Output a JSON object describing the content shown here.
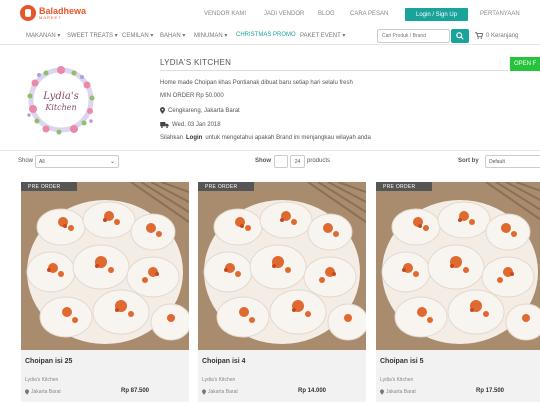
{
  "logo": {
    "main": "Baladhewa",
    "sub": "MARKET"
  },
  "top_links": [
    "VENDOR KAMI",
    "JADI VENDOR",
    "BLOG",
    "CARA PESAN"
  ],
  "login_label": "Login / Sign Up",
  "help_label": "PERTANYAAN",
  "nav": [
    "MAKANAN ▾",
    "SWEET TREATS ▾",
    "CEMILAN ▾",
    "BAHAN ▾",
    "MINUMAN ▾",
    "CHRISTMAS PROMO",
    "PAKET EVENT ▾"
  ],
  "search": {
    "placeholder": "Cari Produk / Brand"
  },
  "cart_label": "0 Keranjang",
  "store": {
    "logo_text_1": "Lydia's",
    "logo_text_2": "Kitchen",
    "name": "LYDIA'S KITCHEN",
    "status": "OPEN F",
    "description": "Home made Choipan khas Pontianak dibuat baru setiap hari selalu fresh",
    "min_order": "MIN ORDER Rp 50.000",
    "location": "Cengkareng, Jakarta Barat",
    "date": "Wed, 03 Jan 2018",
    "login_note_pre": "Silahkan",
    "login_note_link": "Login",
    "login_note_post": "untuk mengetahui apakah Brand ini menjangkau wilayah anda"
  },
  "filters": {
    "show_label": "Show",
    "show_value": "All",
    "per_page_label": "Show",
    "per_page_current": "",
    "per_page_value": "24",
    "per_page_suffix": "products",
    "sort_label": "Sort by",
    "sort_value": "Default"
  },
  "products": [
    {
      "badge": "PRE ORDER",
      "name": "Choipan isi 25",
      "store": "Lydia's Kitchen",
      "location": "Jakarta Barat",
      "price": "Rp 87.500"
    },
    {
      "badge": "PRE ORDER",
      "name": "Choipan isi 4",
      "store": "Lydia's Kitchen",
      "location": "Jakarta Barat",
      "price": "Rp 14.000"
    },
    {
      "badge": "PRE ORDER",
      "name": "Choipan isi 5",
      "store": "Lydia's Kitchen",
      "location": "Jakarta Barat",
      "price": "Rp 17.500"
    }
  ],
  "colors": {
    "accent": "#1aa39a",
    "brand": "#e8542a",
    "open": "#28c33c",
    "badge": "#555555"
  }
}
